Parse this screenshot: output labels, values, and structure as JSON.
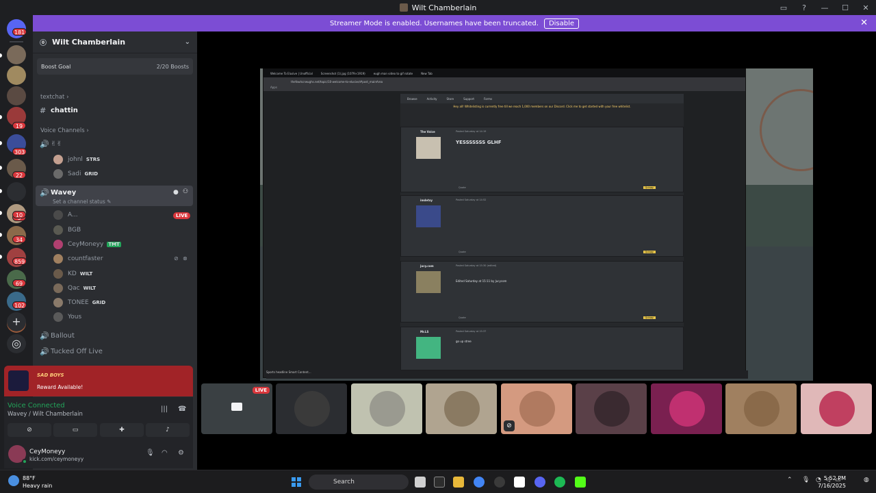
{
  "window": {
    "title": "Wilt Chamberlain",
    "controls": [
      "—",
      "☐",
      "✕"
    ]
  },
  "banner": {
    "text": "Streamer Mode is enabled. Usernames have been truncated.",
    "button": "Disable",
    "close": "✕"
  },
  "guild_badges": [
    "181",
    "19",
    "303",
    "22",
    "3",
    "34",
    "859",
    "10",
    "69",
    "102"
  ],
  "server": {
    "name": "Wilt Chamberlain",
    "boost_label": "Boost Goal",
    "boost_progress": "2/20 Boosts"
  },
  "channels": {
    "textchat_category": "textchat",
    "text_channel": "chattin",
    "voice_category": "Voice Channels",
    "voice_channel_1_users": [
      {
        "name": "johnl",
        "tag": "STRS"
      },
      {
        "name": "Sadi",
        "tag": "GRID"
      }
    ],
    "active_voice": {
      "name": "Wavey",
      "status_placeholder": "Set a channel status",
      "live": "LIVE",
      "users": [
        {
          "name": "A...",
          "tag": ""
        },
        {
          "name": "BGB",
          "tag": ""
        },
        {
          "name": "CeyMoneyy",
          "tag": "TMT"
        },
        {
          "name": "countfaster",
          "tag": ""
        },
        {
          "name": "KD",
          "tag": "WILT"
        },
        {
          "name": "Qac",
          "tag": "WILT"
        },
        {
          "name": "TONEE",
          "tag": "GRID"
        },
        {
          "name": "Yous",
          "tag": ""
        }
      ]
    },
    "other_voice": [
      "Ballout",
      "Tucked Off Live"
    ]
  },
  "notification": {
    "brand": "SAD BOYS",
    "text": "Reward Available!"
  },
  "voice_panel": {
    "status": "Voice Connected",
    "location": "Wavey / Wilt Chamberlain"
  },
  "user_panel": {
    "name": "CeyMoneyy",
    "status": "kick.com/ceymoneyy"
  },
  "stream": {
    "browser_tabs": [
      "Welcome To Elusive | Unofficial",
      "Screenshot (1).jpg (1079×1919)",
      "eugh man video to gif rotate",
      "New Tab"
    ],
    "url": "thefowlscrwughs.net/topic/10-welcome-to-elusive/#post_mainArea",
    "bookmark": "Apps",
    "forum_nav": [
      "Browse",
      "Activity",
      "Store",
      "Support",
      "Forms"
    ],
    "notice": "Hey all! Whitelisting is currently free till we reach 1,000 members on our Discord. Click me to get started with your free whitelist.",
    "posts": [
      {
        "user": "The Voice",
        "meta": "Posted Saturday at 14:19",
        "body": "YESSSSSSS GLHF",
        "react": "Quiqqy",
        "quote": "Quote"
      },
      {
        "user": "imdetsy",
        "meta": "Posted Saturday at 14:52",
        "body": "",
        "react": "Quiqqy",
        "quote": "Quote"
      },
      {
        "user": "jucy.com",
        "meta": "Posted Saturday at 15:30 (edited)",
        "body": "Edited Saturday at 15:11 by Jucycom",
        "react": "Quiqqy",
        "quote": "Quote"
      },
      {
        "user": "Mr.LS",
        "meta": "Posted Saturday at 15:37",
        "body": "go up stree",
        "react": "",
        "quote": ""
      }
    ],
    "inner_taskbar": "Sports headline Smart Content..."
  },
  "thumb_live": "LIVE",
  "taskbar": {
    "temp": "88°F",
    "weather": "Heavy rain",
    "search": "Search",
    "time": "5:52 PM",
    "date": "7/16/2025"
  }
}
